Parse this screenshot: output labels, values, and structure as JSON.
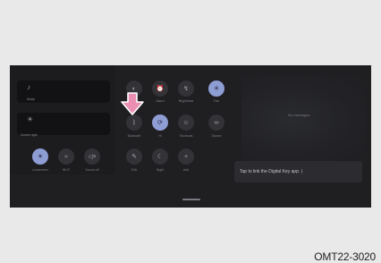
{
  "panel": {
    "tiles": [
      {
        "label": "Music",
        "icon": "music-icon",
        "glyph": "♪"
      },
      {
        "label": "Screen light",
        "icon": "brightness-icon",
        "glyph": "☀"
      }
    ],
    "left_row": [
      {
        "label": "Lockscreen",
        "icon": "sun-icon",
        "glyph": "☀",
        "on": true
      },
      {
        "label": "Wi-Fi",
        "icon": "wifi-icon",
        "glyph": "≈",
        "on": false
      },
      {
        "label": "Sound off",
        "icon": "volume-off-icon",
        "glyph": "◁×",
        "on": false
      }
    ],
    "grid_row1": [
      {
        "label": "Dark",
        "icon": "moon-icon",
        "glyph": "◐",
        "on": false
      },
      {
        "label": "Alarm",
        "icon": "alarm-icon",
        "glyph": "⏰",
        "on": false
      },
      {
        "label": "Brightness",
        "icon": "flash-icon",
        "glyph": "↯",
        "on": false
      },
      {
        "label": "Fan",
        "icon": "fan-icon",
        "glyph": "✳",
        "on": true
      }
    ],
    "grid_row2": [
      {
        "label": "Bluetooth",
        "icon": "bluetooth-icon",
        "glyph": "ᛒ",
        "on": false
      },
      {
        "label": "Hi",
        "icon": "sync-icon",
        "glyph": "⟳",
        "on": true
      },
      {
        "label": "Shortcuts",
        "icon": "person-icon",
        "glyph": "☺",
        "on": false
      },
      {
        "label": "Glance",
        "icon": "glasses-icon",
        "glyph": "∞",
        "on": false
      }
    ],
    "grid_row3": [
      {
        "label": "Edit",
        "icon": "edit-icon",
        "glyph": "✎",
        "on": false
      },
      {
        "label": "Night",
        "icon": "moon-small-icon",
        "glyph": "☾",
        "on": false
      },
      {
        "label": "Add",
        "icon": "plus-icon",
        "glyph": "+",
        "on": false
      }
    ],
    "no_messages": "No messages",
    "banner_text": "Tap to link the Digital Key app. ⟩",
    "figure_code": "OMT22-3020"
  }
}
